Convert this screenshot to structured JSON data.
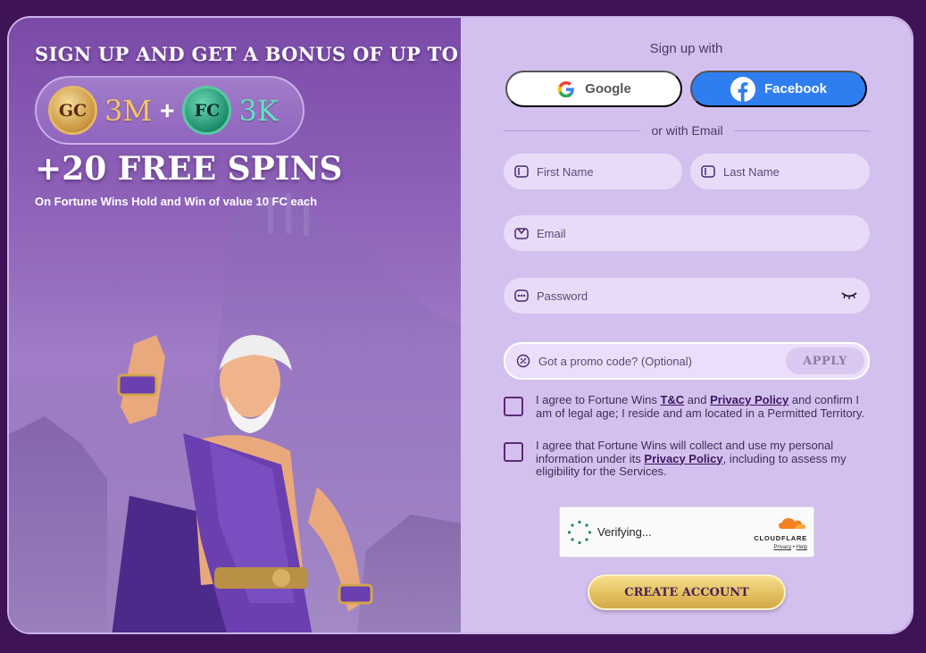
{
  "promo": {
    "headline": "SIGN UP AND GET A BONUS OF UP TO",
    "gc_coin": "GC",
    "gc_amount": "3M",
    "plus": "+",
    "fc_coin": "FC",
    "fc_amount": "3K",
    "spins": "+20 FREE SPINS",
    "spins_subtitle": "On Fortune Wins Hold and Win of value 10 FC each"
  },
  "form": {
    "signup_with": "Sign up with",
    "google_label": "Google",
    "facebook_label": "Facebook",
    "or_email": "or with Email",
    "first_name_placeholder": "First Name",
    "last_name_placeholder": "Last Name",
    "email_placeholder": "Email",
    "password_placeholder": "Password",
    "promo_placeholder": "Got a promo code? (Optional)",
    "apply_label": "APPLY",
    "agree1_pre": "I agree to Fortune Wins ",
    "agree1_tc": "T&C",
    "agree1_and": " and ",
    "agree1_privacy": "Privacy Policy",
    "agree1_post": " and confirm I am of legal age; I reside and am located in a Permitted Territory.",
    "agree2_pre": "I agree that Fortune Wins will collect and use my personal information under its ",
    "agree2_privacy": "Privacy Policy",
    "agree2_post": ", including to assess my eligibility for the Services.",
    "captcha_status": "Verifying...",
    "captcha_brand": "CLOUDFLARE",
    "captcha_privacy": "Privacy",
    "captcha_sep": " • ",
    "captcha_help": "Help",
    "create_label": "CREATE ACCOUNT"
  },
  "colors": {
    "background": "#3f1457",
    "form_panel": "#d4c0ee",
    "facebook": "#2f7ef0",
    "gold_button": "#e2bd5c"
  },
  "icons": [
    "google-icon",
    "facebook-icon",
    "id-card-icon",
    "mail-icon",
    "password-icon",
    "eye-closed-icon",
    "promo-tag-icon",
    "spinner-icon",
    "cloudflare-icon"
  ]
}
